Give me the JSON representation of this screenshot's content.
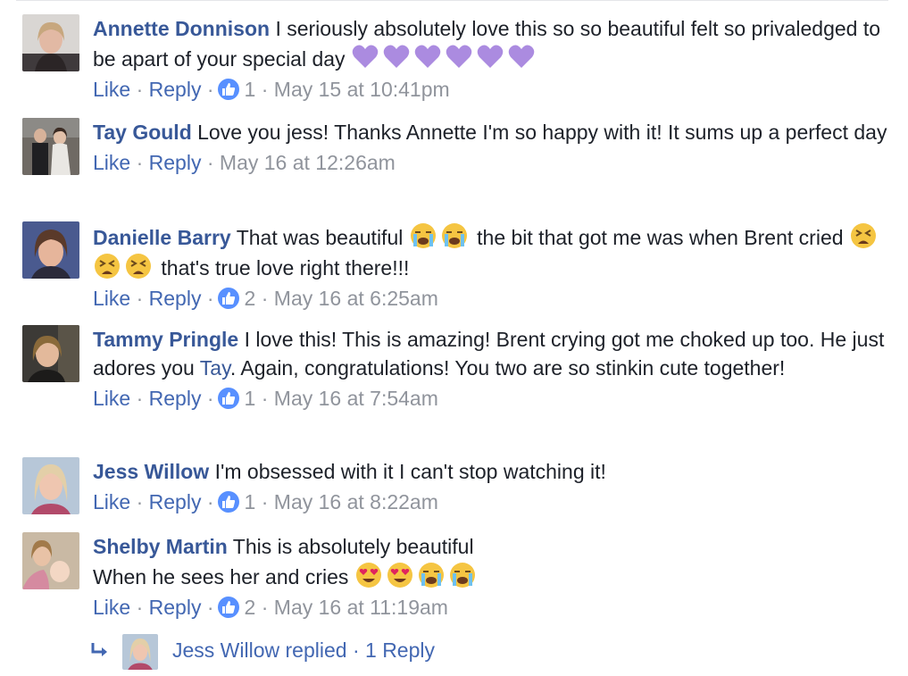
{
  "comments": [
    {
      "name": "Annette Donnison",
      "text_1": "I seriously absolutely love this so so beautiful felt so privaledged to be apart of your special day",
      "emoji": [
        "purple-heart",
        "purple-heart",
        "purple-heart",
        "purple-heart",
        "purple-heart",
        "purple-heart"
      ],
      "like": "Like",
      "reply": "Reply",
      "reactions": "1",
      "time": "May 15 at 10:41pm"
    },
    {
      "name": "Tay Gould",
      "text_1": "Love you jess! Thanks Annette I'm so happy with it! It sums up a perfect day",
      "like": "Like",
      "reply": "Reply",
      "time": "May 16 at 12:26am"
    },
    {
      "name": "Danielle Barry",
      "text_1": "That was beautiful",
      "emoji_1": [
        "loudly-crying-face",
        "loudly-crying-face"
      ],
      "text_2": "the bit that got me was when Brent cried",
      "emoji_2": [
        "tired-face",
        "tired-face",
        "tired-face"
      ],
      "text_3": "that's true love right there!!!",
      "like": "Like",
      "reply": "Reply",
      "reactions": "2",
      "time": "May 16 at 6:25am"
    },
    {
      "name": "Tammy Pringle",
      "text_1": "I love this! This is amazing! Brent crying got me choked up too. He just adores you",
      "mention": "Tay",
      "text_2": ". Again, congratulations! You two are so stinkin cute together!",
      "like": "Like",
      "reply": "Reply",
      "reactions": "1",
      "time": "May 16 at 7:54am"
    },
    {
      "name": "Jess Willow",
      "text_1": "I'm obsessed with it I can't stop watching it!",
      "like": "Like",
      "reply": "Reply",
      "reactions": "1",
      "time": "May 16 at 8:22am"
    },
    {
      "name": "Shelby Martin",
      "text_1": "This is absolutely beautiful",
      "text_2": "When he sees her and cries",
      "emoji": [
        "heart-eyes-face",
        "heart-eyes-face",
        "loudly-crying-face",
        "loudly-crying-face"
      ],
      "like": "Like",
      "reply": "Reply",
      "reactions": "2",
      "time": "May 16 at 11:19am"
    }
  ],
  "replies_link": {
    "who": "Jess Willow replied",
    "count": "1 Reply"
  },
  "colors": {
    "name": "#385898",
    "link": "#4267b2",
    "meta": "#90949c",
    "like_badge": "#5890ff",
    "text": "#1d2129"
  },
  "separator": "·"
}
